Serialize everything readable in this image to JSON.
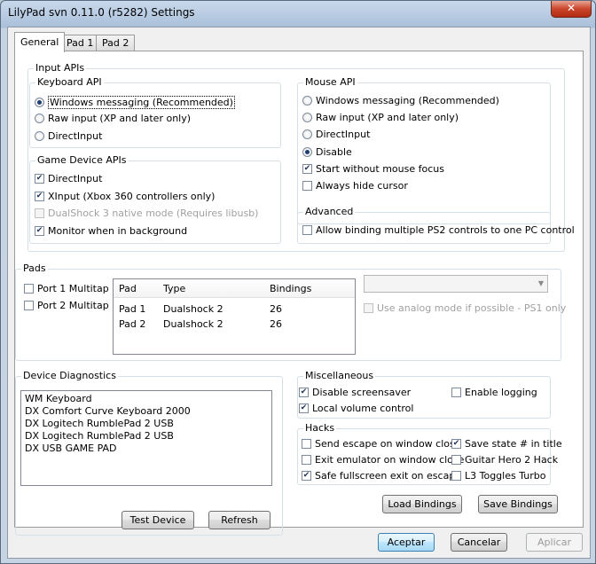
{
  "window": {
    "title": "LilyPad svn 0.11.0 (r5282) Settings",
    "close_glyph": "✕"
  },
  "tabs": [
    {
      "label": "General",
      "active": true
    },
    {
      "label": "Pad 1",
      "active": false
    },
    {
      "label": "Pad 2",
      "active": false
    }
  ],
  "input_apis": {
    "label": "Input APIs",
    "keyboard": {
      "label": "Keyboard API",
      "options": [
        {
          "label": "Windows messaging (Recommended)",
          "selected": true
        },
        {
          "label": "Raw input (XP and later only)",
          "selected": false
        },
        {
          "label": "DirectInput",
          "selected": false
        }
      ]
    },
    "game_device": {
      "label": "Game Device APIs",
      "options": [
        {
          "label": "DirectInput",
          "checked": true,
          "enabled": true
        },
        {
          "label": "XInput (Xbox 360 controllers only)",
          "checked": true,
          "enabled": true
        },
        {
          "label": "DualShock 3 native mode (Requires libusb)",
          "checked": false,
          "enabled": false
        },
        {
          "label": "Monitor when in background",
          "checked": true,
          "enabled": true
        }
      ]
    },
    "mouse": {
      "label": "Mouse API",
      "options": [
        {
          "label": "Windows messaging (Recommended)",
          "selected": false
        },
        {
          "label": "Raw input (XP and later only)",
          "selected": false
        },
        {
          "label": "DirectInput",
          "selected": false
        },
        {
          "label": "Disable",
          "selected": true
        }
      ],
      "checks": [
        {
          "label": "Start without mouse focus",
          "checked": true
        },
        {
          "label": "Always hide cursor",
          "checked": false
        }
      ]
    },
    "advanced": {
      "label": "Advanced",
      "option": {
        "label": "Allow binding multiple PS2 controls to one PC control",
        "checked": false
      }
    }
  },
  "pads": {
    "label": "Pads",
    "multitaps": [
      {
        "label": "Port 1 Multitap",
        "checked": false
      },
      {
        "label": "Port 2 Multitap",
        "checked": false
      }
    ],
    "table": {
      "headers": [
        "Pad",
        "Type",
        "Bindings"
      ],
      "rows": [
        [
          "Pad 1",
          "Dualshock 2",
          "26"
        ],
        [
          "Pad 2",
          "Dualshock 2",
          "26"
        ]
      ]
    },
    "pad_type_select": {
      "value": ""
    },
    "analog_option": {
      "label": "Use analog mode if possible - PS1 only",
      "checked": false,
      "enabled": false
    }
  },
  "diagnostics": {
    "label": "Device Diagnostics",
    "devices": [
      "WM Keyboard",
      "DX Comfort Curve Keyboard 2000",
      "DX Logitech RumblePad 2 USB",
      "DX Logitech RumblePad 2 USB",
      "DX USB GAME PAD"
    ],
    "test_button": "Test Device",
    "refresh_button": "Refresh"
  },
  "misc": {
    "label": "Miscellaneous",
    "options": [
      {
        "label": "Disable screensaver",
        "checked": true
      },
      {
        "label": "Enable logging",
        "checked": false
      },
      {
        "label": "Local volume control",
        "checked": true
      }
    ]
  },
  "hacks": {
    "label": "Hacks",
    "options": [
      {
        "label": "Send escape on window close",
        "checked": false
      },
      {
        "label": "Save state # in title",
        "checked": true
      },
      {
        "label": "Exit emulator on window close",
        "checked": false
      },
      {
        "label": "Guitar Hero 2 Hack",
        "checked": false
      },
      {
        "label": "Safe fullscreen exit on escape",
        "checked": true
      },
      {
        "label": "L3 Toggles Turbo",
        "checked": false
      }
    ]
  },
  "bindings": {
    "load": "Load Bindings",
    "save": "Save Bindings"
  },
  "dialog_buttons": {
    "ok": "Aceptar",
    "cancel": "Cancelar",
    "apply": "Aplicar"
  }
}
